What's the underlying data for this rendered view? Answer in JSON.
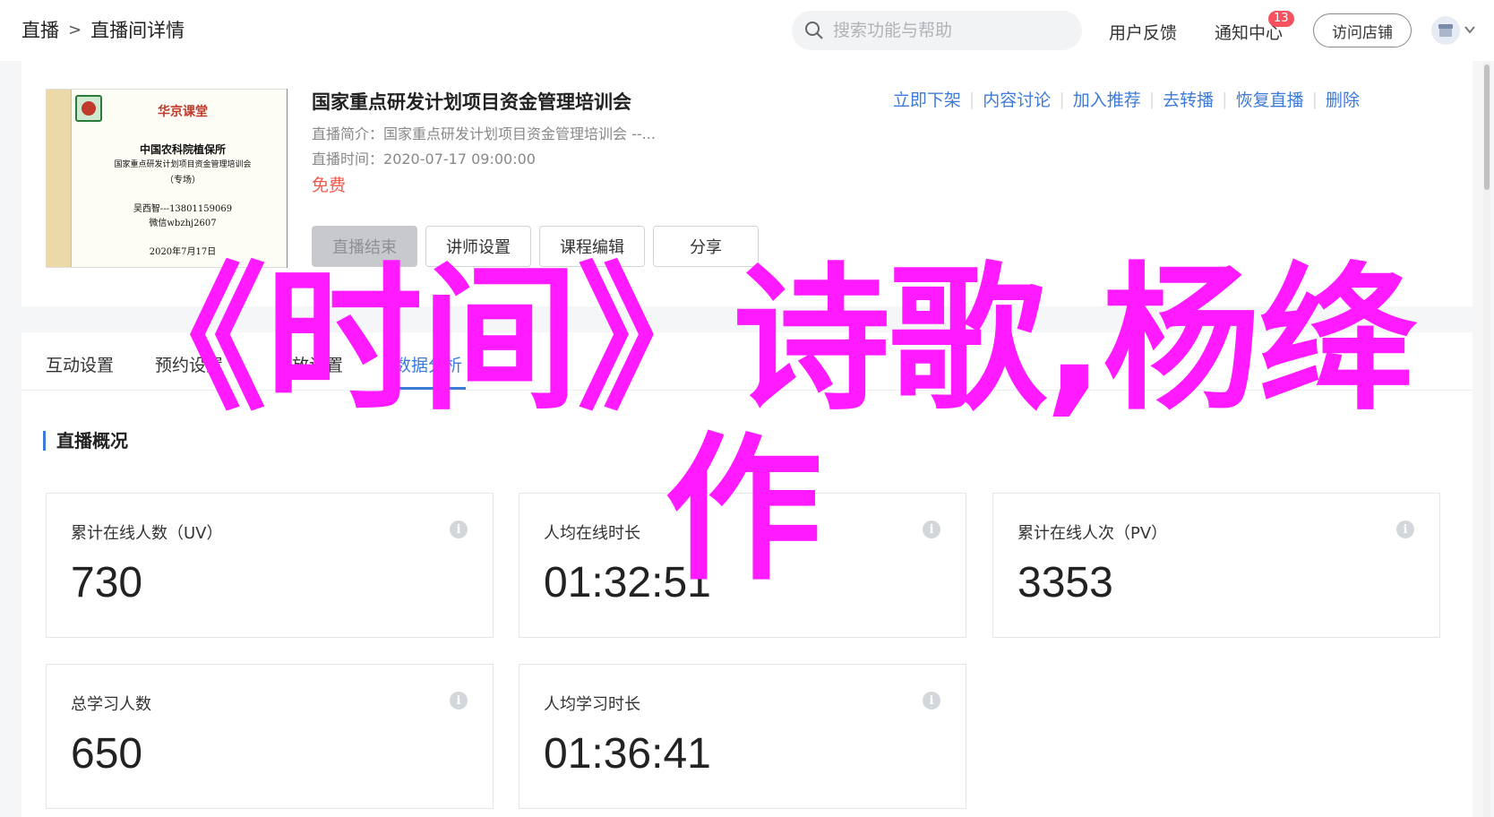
{
  "breadcrumb": {
    "root": "直播",
    "separator": ">",
    "current": "直播间详情"
  },
  "search": {
    "placeholder": "搜索功能与帮助"
  },
  "topbar": {
    "feedback": "用户反馈",
    "notifications": "通知中心",
    "notification_count": "13",
    "visit_store": "访问店铺"
  },
  "live": {
    "title": "国家重点研发计划项目资金管理培训会",
    "intro_label": "直播简介：",
    "intro": "国家重点研发计划项目资金管理培训会 --...",
    "time_label": "直播时间：",
    "time": "2020-07-17 09:00:00",
    "price": "免费",
    "cover": {
      "brand": "华京课堂",
      "org": "中国农科院植保所",
      "topic": "国家重点研发计划项目资金管理培训会",
      "subtitle": "（专场）",
      "contact1": "吴西智---13801159069",
      "contact2": "微信wbzhj2607",
      "date": "2020年7月17日"
    },
    "actions": [
      "立即下架",
      "内容讨论",
      "加入推荐",
      "去转播",
      "恢复直播",
      "删除"
    ],
    "buttons": {
      "end_live": "直播结束",
      "teacher": "讲师设置",
      "course_edit": "课程编辑",
      "share": "分享"
    }
  },
  "tabs": [
    "互动设置",
    "预约设置",
    "回放设置",
    "数据分析"
  ],
  "overview": {
    "title": "直播概况",
    "stats": [
      {
        "label": "累计在线人数（UV）",
        "value": "730"
      },
      {
        "label": "人均在线时长",
        "value": "01:32:51"
      },
      {
        "label": "累计在线人次（PV）",
        "value": "3353"
      },
      {
        "label": "总学习人数",
        "value": "650"
      },
      {
        "label": "人均学习时长",
        "value": "01:36:41"
      }
    ]
  },
  "overlay": {
    "line1": "《时间》诗歌,杨绛",
    "line2": "作"
  },
  "colors": {
    "accent": "#3d7bd9",
    "danger": "#f05a4e",
    "overlay": "#ff1aff",
    "badge": "#f5515f"
  }
}
